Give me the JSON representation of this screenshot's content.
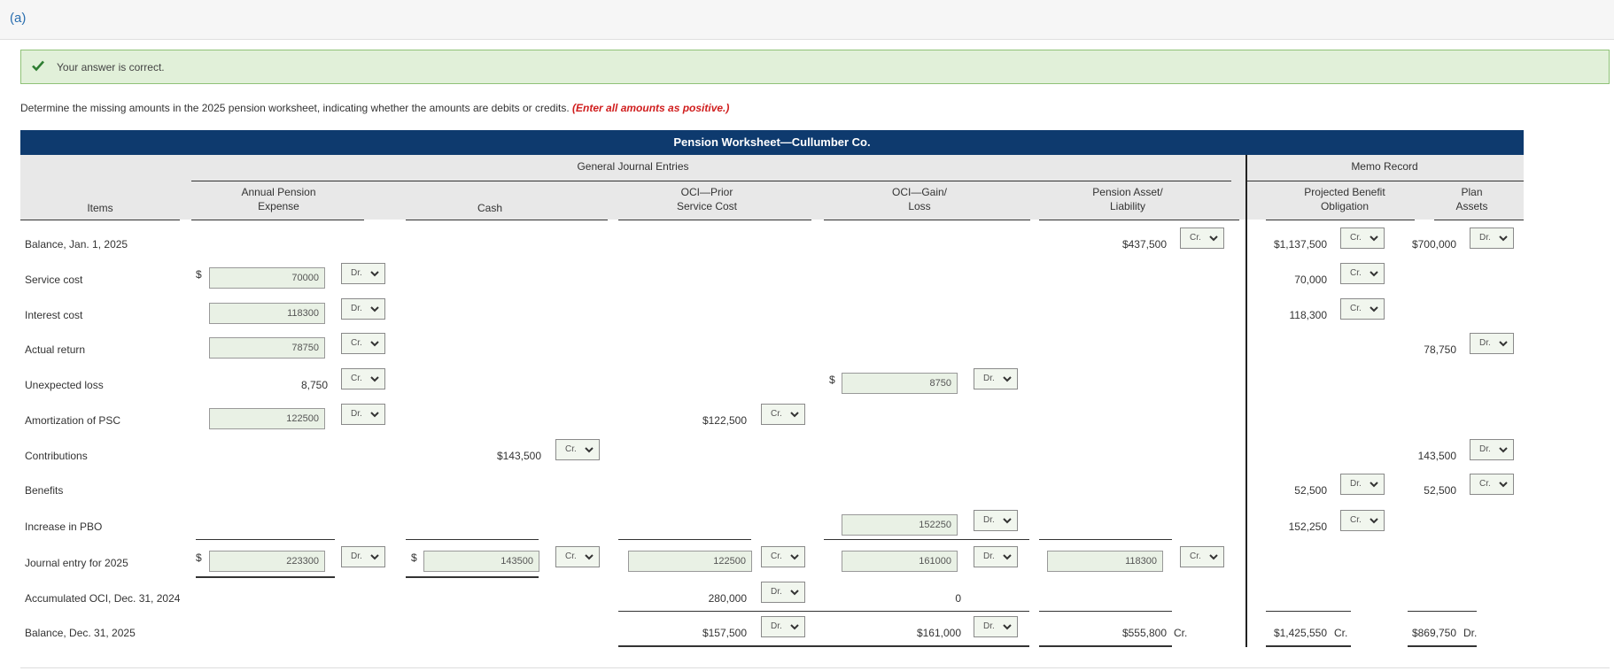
{
  "part_label": "(a)",
  "feedback": {
    "message": "Your answer is correct."
  },
  "instructions": {
    "text": "Determine the missing amounts in the 2025 pension worksheet, indicating whether the amounts are debits or credits.",
    "note": "(Enter all amounts as positive.)"
  },
  "worksheet": {
    "title": "Pension Worksheet—Cullumber Co.",
    "gje_header": "General Journal Entries",
    "memo_header": "Memo Record",
    "col_items": "Items",
    "col_ape": [
      "Annual Pension",
      "Expense"
    ],
    "col_cash": "Cash",
    "col_ocipsc": [
      "OCI—Prior",
      "Service Cost"
    ],
    "col_ocigl": [
      "OCI—Gain/",
      "Loss"
    ],
    "col_pal": [
      "Pension Asset/",
      "Liability"
    ],
    "col_pbo": [
      "Projected Benefit",
      "Obligation"
    ],
    "col_pa": [
      "Plan",
      "Assets"
    ],
    "currency": "$",
    "rows": [
      {
        "item": "Balance, Jan. 1, 2025",
        "pal": "$437,500",
        "pal_dc": "Cr.",
        "pbo": "$1,137,500",
        "pbo_dc": "Cr.",
        "pa": "$700,000",
        "pa_dc": "Dr."
      },
      {
        "item": "Service cost",
        "ape_input": "70000",
        "ape_dc": "Dr.",
        "pbo": "70,000",
        "pbo_dc": "Cr."
      },
      {
        "item": "Interest cost",
        "ape_input": "118300",
        "ape_dc": "Dr.",
        "pbo": "118,300",
        "pbo_dc": "Cr."
      },
      {
        "item": "Actual return",
        "ape_input": "78750",
        "ape_dc": "Cr.",
        "pa": "78,750",
        "pa_dc": "Dr."
      },
      {
        "item": "Unexpected loss",
        "ape": "8,750",
        "ape_dc": "Cr.",
        "ocigl_input": "8750",
        "ocigl_dc": "Dr."
      },
      {
        "item": "Amortization of PSC",
        "ape_input": "122500",
        "ape_dc": "Dr.",
        "ocipsc": "$122,500",
        "ocipsc_dc": "Cr."
      },
      {
        "item": "Contributions",
        "cash": "$143,500",
        "cash_dc": "Cr.",
        "pa": "143,500",
        "pa_dc": "Dr."
      },
      {
        "item": "Benefits",
        "pbo": "52,500",
        "pbo_dc": "Dr.",
        "pa": "52,500",
        "pa_dc": "Cr."
      },
      {
        "item": "Increase in PBO",
        "ocigl_input": "152250",
        "ocigl_dc": "Dr.",
        "pbo": "152,250",
        "pbo_dc": "Cr."
      },
      {
        "item": "Journal entry for 2025",
        "ape_input": "223300",
        "ape_dc": "Dr.",
        "cash_input": "143500",
        "cash_dc": "Cr.",
        "ocipsc_input": "122500",
        "ocipsc_dc": "Cr.",
        "ocigl_input": "161000",
        "ocigl_dc": "Dr.",
        "pal_input": "118300",
        "pal_dc": "Cr."
      },
      {
        "item": "Accumulated OCI, Dec. 31, 2024",
        "ocipsc": "280,000",
        "ocipsc_dc": "Dr.",
        "ocigl": "0"
      },
      {
        "item": "Balance, Dec. 31, 2025",
        "ocipsc": "$157,500",
        "ocipsc_dc": "Dr.",
        "ocigl": "$161,000",
        "ocigl_dc": "Dr.",
        "pal": "$555,800",
        "pal_dc_text": "Cr.",
        "pbo": "$1,425,550",
        "pbo_dc_text": "Cr.",
        "pa": "$869,750",
        "pa_dc_text": "Dr."
      }
    ]
  }
}
